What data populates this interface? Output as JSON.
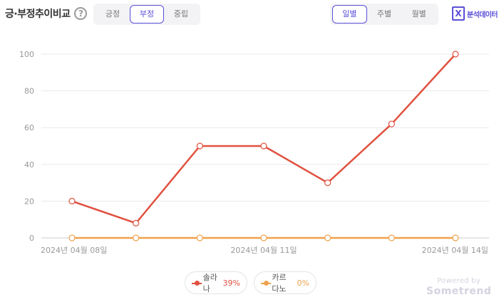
{
  "header": {
    "title": "긍·부정추이비교",
    "help_glyph": "?",
    "sentiment_tabs": [
      "긍정",
      "부정",
      "중립"
    ],
    "sentiment_selected": "부정",
    "period_tabs": [
      "일별",
      "주별",
      "월별"
    ],
    "period_selected": "일별",
    "analysis_label": "분석데이터",
    "analysis_icon": "X"
  },
  "chart_data": {
    "type": "line",
    "x": [
      "2024-04-08",
      "2024-04-09",
      "2024-04-10",
      "2024-04-11",
      "2024-04-12",
      "2024-04-13",
      "2024-04-14"
    ],
    "x_tick_labels": [
      "2024년 04월 08일",
      "2024년 04월 11일",
      "2024년 04월 14일"
    ],
    "yticks": [
      0,
      20,
      40,
      60,
      80,
      100
    ],
    "ylim": [
      0,
      100
    ],
    "grid": "horizontal",
    "legend_position": "bottom-center",
    "series": [
      {
        "name": "솔라나",
        "share": "39%",
        "color": "#e0513f",
        "values": [
          20,
          8,
          50,
          50,
          30,
          62,
          100
        ]
      },
      {
        "name": "카르다노",
        "share": "0%",
        "color": "#efa24e",
        "values": [
          0,
          0,
          0,
          0,
          0,
          0,
          0
        ]
      }
    ]
  },
  "legend": [
    {
      "name": "솔라나",
      "share": "39%",
      "color": "#e0513f"
    },
    {
      "name": "카르다노",
      "share": "0%",
      "color": "#efa24e"
    }
  ],
  "branding": {
    "powered_by": "Powered by",
    "brand": "Sometrend"
  }
}
